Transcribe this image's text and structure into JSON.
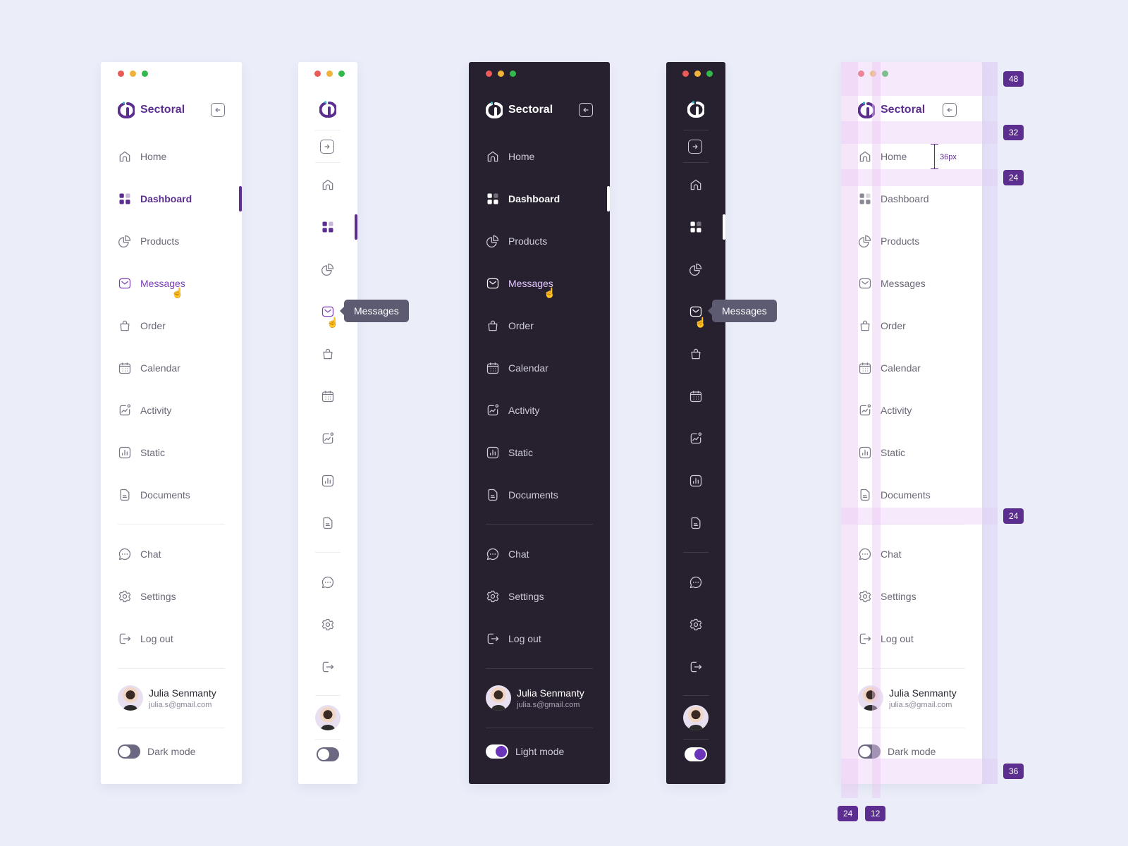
{
  "brand": {
    "name": "Sectoral"
  },
  "nav_main": [
    {
      "label": "Home",
      "icon": "home-icon"
    },
    {
      "label": "Dashboard",
      "icon": "dashboard-icon"
    },
    {
      "label": "Products",
      "icon": "pie-chart-icon"
    },
    {
      "label": "Messages",
      "icon": "mail-icon"
    },
    {
      "label": "Order",
      "icon": "bag-icon"
    },
    {
      "label": "Calendar",
      "icon": "calendar-icon"
    },
    {
      "label": "Activity",
      "icon": "activity-icon"
    },
    {
      "label": "Static",
      "icon": "bar-chart-icon"
    },
    {
      "label": "Documents",
      "icon": "document-icon"
    }
  ],
  "nav_secondary": [
    {
      "label": "Chat",
      "icon": "chat-icon"
    },
    {
      "label": "Settings",
      "icon": "gear-icon"
    },
    {
      "label": "Log out",
      "icon": "logout-icon"
    }
  ],
  "active_item": "Dashboard",
  "hover_item": "Messages",
  "tooltip": {
    "text": "Messages"
  },
  "user": {
    "name": "Julia Senmanty",
    "email": "julia.s@gmail.com"
  },
  "light_toggle": {
    "label": "Dark mode",
    "state": "off"
  },
  "dark_toggle": {
    "label": "Light mode",
    "state": "on"
  },
  "spec": {
    "measure_label": "36px",
    "badges_right": [
      "48",
      "32",
      "24",
      "24",
      "36"
    ],
    "badges_bottom": [
      "24",
      "12"
    ]
  },
  "colors": {
    "accent": "#5b2e8f",
    "dark_bg": "#27202f",
    "page_bg": "#ebeef9",
    "tooltip_bg": "#5d5b72"
  }
}
